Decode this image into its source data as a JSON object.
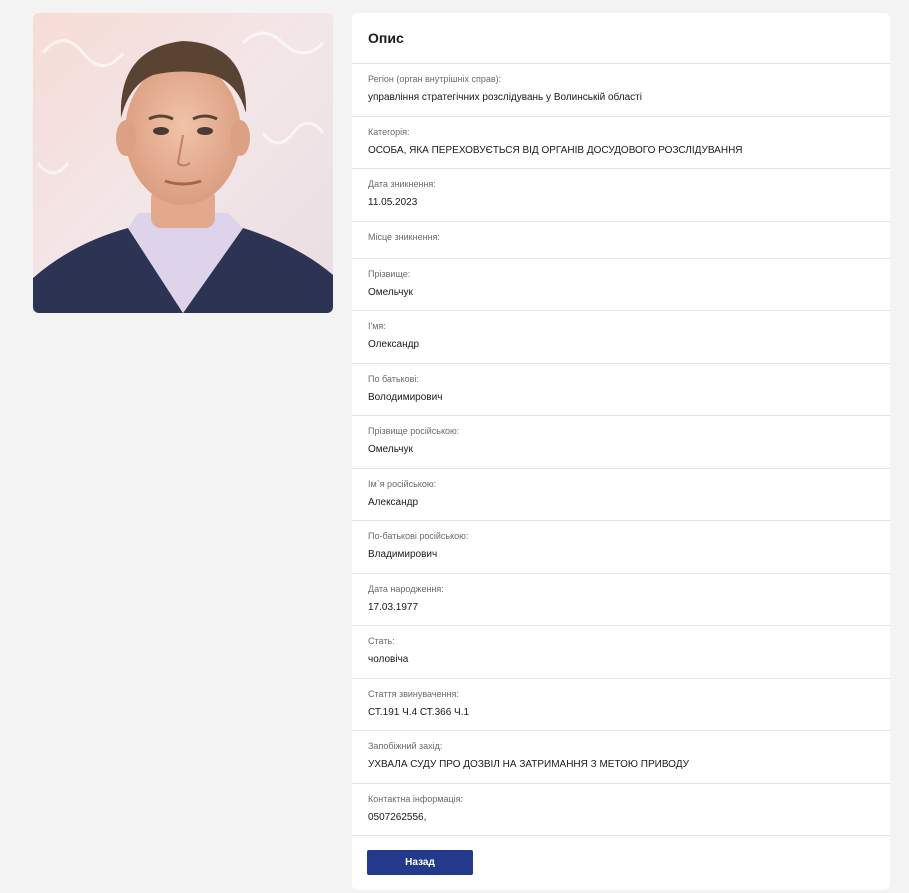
{
  "photo": {
    "icon": "person-photo"
  },
  "card": {
    "title": "Опис",
    "fields": [
      {
        "label": "Регіон (орган внутрішніх справ):",
        "value": "управління стратегічних розслідувань у Волинській області"
      },
      {
        "label": "Категорія:",
        "value": "ОСОБА, ЯКА ПЕРЕХОВУЄТЬСЯ ВІД ОРГАНІВ ДОСУДОВОГО РОЗСЛІДУВАННЯ"
      },
      {
        "label": "Дата зникнення:",
        "value": "11.05.2023"
      },
      {
        "label": "Місце зникнення:",
        "value": ""
      },
      {
        "label": "Прізвище:",
        "value": "Омельчук"
      },
      {
        "label": "І'мя:",
        "value": "Олександр"
      },
      {
        "label": "По батькові:",
        "value": "Володимирович"
      },
      {
        "label": "Прізвище російською:",
        "value": "Омельчук"
      },
      {
        "label": "Ім`я російською:",
        "value": "Александр"
      },
      {
        "label": "По-батькові російською:",
        "value": "Владимирович"
      },
      {
        "label": "Дата народження:",
        "value": "17.03.1977"
      },
      {
        "label": "Стать:",
        "value": "чоловіча"
      },
      {
        "label": "Стаття звинувачення:",
        "value": "СТ.191 Ч.4 СТ.366 Ч.1"
      },
      {
        "label": "Запобіжний захід:",
        "value": "УХВАЛА СУДУ ПРО ДОЗВІЛ НА ЗАТРИМАННЯ З МЕТОЮ ПРИВОДУ"
      },
      {
        "label": "Контактна інформація:",
        "value": "0507262556,"
      }
    ],
    "back_label": "Назад"
  },
  "colors": {
    "background": "#f3f3f3",
    "card": "#ffffff",
    "button": "#233a8c",
    "divider": "#e4e4e4"
  }
}
